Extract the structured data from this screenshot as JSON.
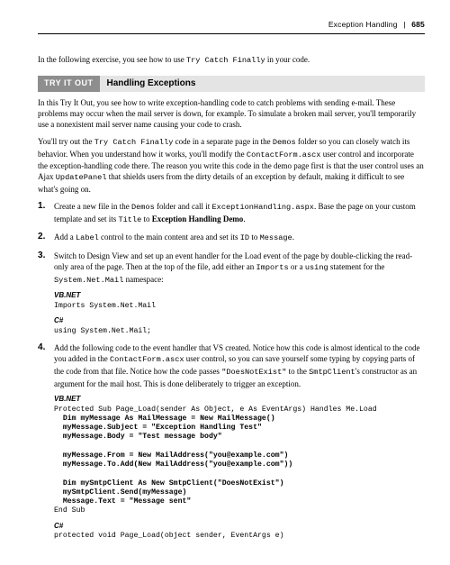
{
  "header": {
    "section": "Exception Handling",
    "separator": "|",
    "page": "685"
  },
  "intro": "In the following exercise, you see how to use Try Catch Finally in your code.",
  "tryitout": {
    "tag": "TRY IT OUT",
    "title": "Handling Exceptions"
  },
  "p1": "In this Try It Out, you see how to write exception-handling code to catch problems with sending e-mail. These problems may occur when the mail server is down, for example. To simulate a broken mail server, you'll temporarily use a nonexistent mail server name causing your code to crash.",
  "p2": "You'll try out the Try Catch Finally code in a separate page in the Demos folder so you can closely watch its behavior. When you understand how it works, you'll modify the ContactForm.ascx user control and incorporate the exception-handling code there. The reason you write this code in the demo page first is that the user control uses an Ajax UpdatePanel that shields users from the dirty details of an exception by default, making it difficult to see what's going on.",
  "steps": {
    "s1": "Create a new file in the Demos folder and call it ExceptionHandling.aspx. Base the page on your custom template and set its Title to Exception Handling Demo.",
    "s2": "Add a Label control to the main content area and set its ID to Message.",
    "s3": "Switch to Design View and set up an event handler for the Load event of the page by double-clicking the read-only area of the page. Then at the top of the file, add either an Imports or a using statement for the System.Net.Mail namespace:",
    "s3_vb_label": "VB.NET",
    "s3_vb_code": "Imports System.Net.Mail",
    "s3_cs_label": "C#",
    "s3_cs_code": "using System.Net.Mail;",
    "s4": "Add the following code to the event handler that VS created. Notice how this code is almost identical to the code you added in the ContactForm.ascx user control, so you can save yourself some typing by copying parts of the code from that file. Notice how the code passes \"DoesNotExist\" to the SmtpClient's constructor as an argument for the mail host. This is done deliberately to trigger an exception.",
    "s4_vb_label": "VB.NET",
    "s4_vb_code": "Protected Sub Page_Load(sender As Object, e As EventArgs) Handles Me.Load\n  Dim myMessage As MailMessage = New MailMessage()\n  myMessage.Subject = \"Exception Handling Test\"\n  myMessage.Body = \"Test message body\"\n\n  myMessage.From = New MailAddress(\"you@example.com\")\n  myMessage.To.Add(New MailAddress(\"you@example.com\"))\n\n  Dim mySmtpClient As New SmtpClient(\"DoesNotExist\")\n  mySmtpClient.Send(myMessage)\n  Message.Text = \"Message sent\"\nEnd Sub",
    "s4_cs_label": "C#",
    "s4_cs_code": "protected void Page_Load(object sender, EventArgs e)"
  }
}
